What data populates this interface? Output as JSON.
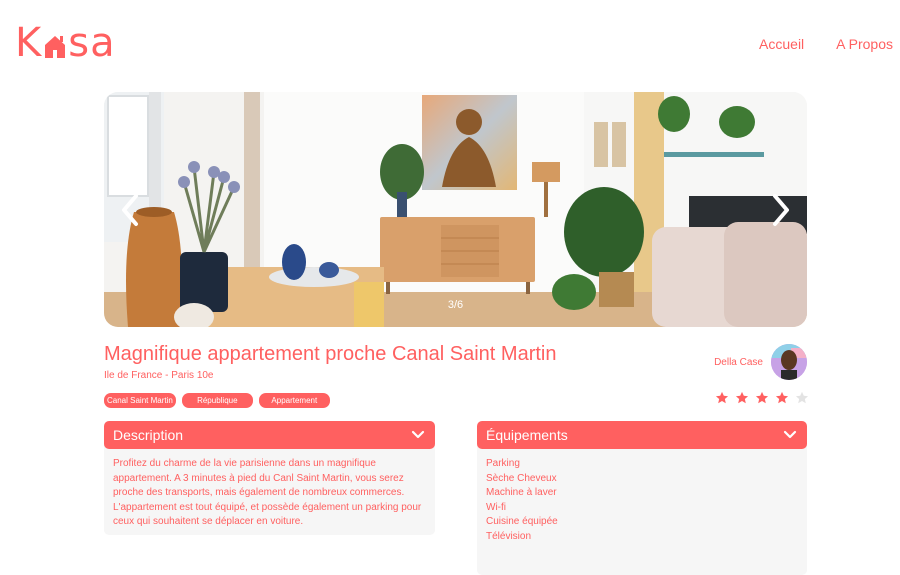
{
  "header": {
    "logo_text_left": "K",
    "logo_text_right": "sa",
    "nav": [
      {
        "label": "Accueil"
      },
      {
        "label": "A Propos"
      }
    ]
  },
  "gallery": {
    "counter": "3/6",
    "prev_icon": "chevron-left-icon",
    "next_icon": "chevron-right-icon"
  },
  "listing": {
    "title": "Magnifique appartement proche Canal Saint Martin",
    "location": "Ile de France - Paris 10e",
    "tags": [
      "Canal Saint Martin",
      "République",
      "Appartement"
    ],
    "host_name": "Della Case",
    "rating": 4,
    "rating_max": 5
  },
  "description": {
    "label": "Description",
    "text": "Profitez du charme de la vie parisienne dans un magnifique appartement. A 3 minutes à pied du Canl Saint Martin, vous serez proche des transports, mais également de nombreux commerces. L'appartement est tout équipé, et possède également un parking pour ceux qui souhaitent se déplacer en voiture."
  },
  "equipments": {
    "label": "Équipements",
    "items": [
      "Parking",
      "Sèche Cheveux",
      "Machine à laver",
      "Wi-fi",
      "Cuisine équipée",
      "Télévision"
    ]
  },
  "colors": {
    "accent": "#FF6060",
    "panel_bg": "#F6F6F6",
    "star_empty": "#E3E3E3"
  }
}
